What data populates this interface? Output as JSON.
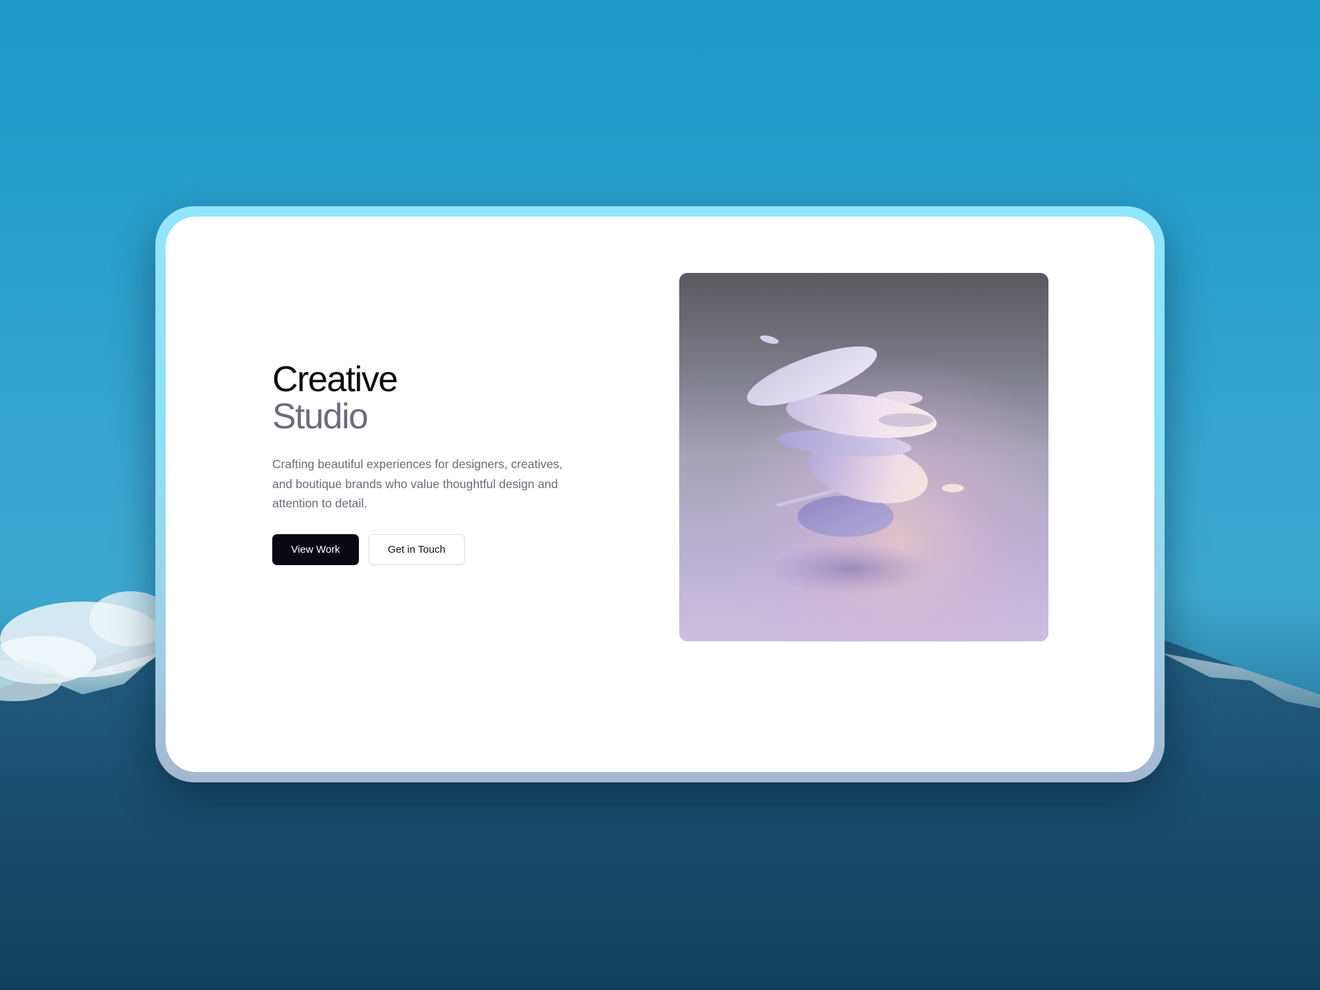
{
  "hero": {
    "title_line1": "Creative",
    "title_line2": "Studio",
    "description": "Crafting beautiful experiences for designers, creatives, and boutique brands who value thoughtful design and attention to detail.",
    "primary_button": "View Work",
    "secondary_button": "Get in Touch"
  },
  "colors": {
    "sky": "#2a9fcb",
    "card_border": "#8ae0f6",
    "title_primary": "#0b0b12",
    "title_secondary": "#6e6b7e",
    "button_dark": "#0a0812"
  }
}
